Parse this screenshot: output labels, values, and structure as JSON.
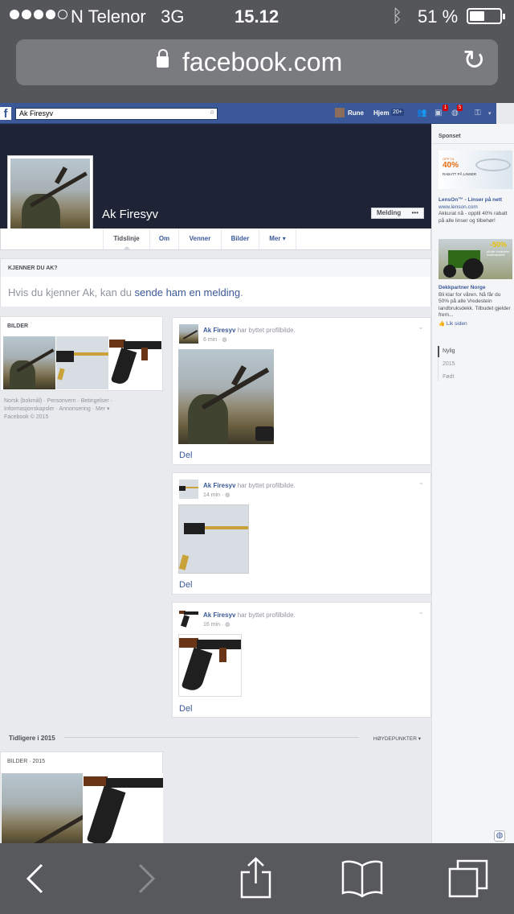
{
  "status": {
    "carrier": "N Telenor",
    "network": "3G",
    "time": "15.12",
    "battery": "51 %",
    "battery_fraction": 0.51
  },
  "browser": {
    "url": "facebook.com"
  },
  "fb": {
    "search_value": "Ak Firesyv",
    "user": "Rune",
    "home": "Hjem",
    "home_badge": "20+",
    "badges": [
      "1",
      "5"
    ]
  },
  "profile": {
    "name": "Ak Firesyv",
    "message_button": "Melding",
    "more_button": "•••",
    "tabs": [
      "Tidslinje",
      "Om",
      "Venner",
      "Bilder",
      "Mer ▾"
    ]
  },
  "know": {
    "heading": "KJENNER DU AK?",
    "text_prefix": "Hvis du kjenner Ak, kan du ",
    "link": "sende ham en melding",
    "suffix": "."
  },
  "photos": {
    "heading": "BILDER"
  },
  "footer": {
    "line1": "Norsk (bokmål) · Personvern · Betingelser ·",
    "line2": "Informasjonskapsler · Annonsering · Mer ▾",
    "line3": "Facebook © 2015"
  },
  "posts": [
    {
      "author": "Ak Firesyv",
      "action": "har byttet profilbilde.",
      "time": "6 min · ◍",
      "share": "Del"
    },
    {
      "author": "Ak Firesyv",
      "action": "har byttet profilbilde.",
      "time": "14 min · ◍",
      "share": "Del"
    },
    {
      "author": "Ak Firesyv",
      "action": "har byttet profilbilde.",
      "time": "16 min · ◍",
      "share": "Del"
    }
  ],
  "sidebar": {
    "sponsored": "Sponset",
    "ad1": {
      "title": "LensOn™ - Linser på nett",
      "url": "www.lenson.com",
      "text": "Akkurat nå - opptil 40% rabatt på alle linser og tilbehør!",
      "img_text1": "OPP TIL",
      "img_text2": "40%",
      "img_text3": "RABATT PÅ LINSER"
    },
    "ad2": {
      "title": "Dekkpartner Norge",
      "text": "Bli klar for våren. Nå får du 50% på alle Vredestein landbruksdekk. Tilbudet gjelder frem...",
      "like": "Lik siden",
      "img_text1": "-50%",
      "img_text2": "på alle Vredestein landbruksdekk"
    },
    "timeline": [
      "Nylig",
      "2015",
      "Født"
    ]
  },
  "earlier": {
    "label": "Tidligere i 2015",
    "highlights": "HØYDEPUNKTER ▾",
    "photos_heading": "BILDER · 2015"
  }
}
